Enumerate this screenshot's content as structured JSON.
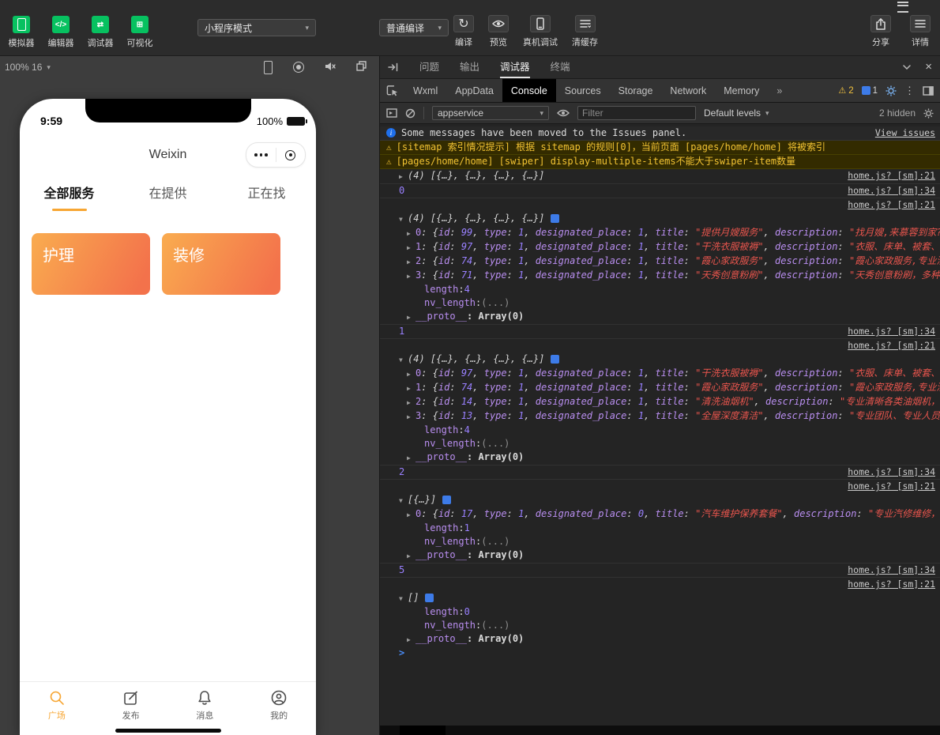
{
  "header": {
    "nav_buttons": [
      {
        "label": "模拟器"
      },
      {
        "label": "编辑器"
      },
      {
        "label": "调试器"
      },
      {
        "label": "可视化"
      }
    ],
    "mode_select": {
      "value": "小程序模式"
    },
    "compile_select": {
      "value": "普通编译"
    },
    "actions": [
      {
        "label": "编译"
      },
      {
        "label": "预览"
      },
      {
        "label": "真机调试"
      },
      {
        "label": "清缓存"
      }
    ],
    "share": {
      "label": "分享"
    },
    "detail": {
      "label": "详情"
    }
  },
  "simulator": {
    "zoom_label": "100% 16",
    "phone": {
      "time": "9:59",
      "battery": "100%",
      "title": "Weixin",
      "tabs": [
        {
          "label": "全部服务",
          "active": true
        },
        {
          "label": "在提供"
        },
        {
          "label": "正在找"
        }
      ],
      "cards": [
        {
          "label": "护理"
        },
        {
          "label": "装修"
        }
      ],
      "tabbar": [
        {
          "label": "广场",
          "active": true
        },
        {
          "label": "发布"
        },
        {
          "label": "消息"
        },
        {
          "label": "我的"
        }
      ]
    }
  },
  "devtools": {
    "drawer_tabs": [
      {
        "label": "问题"
      },
      {
        "label": "输出"
      },
      {
        "label": "调试器",
        "active": true
      },
      {
        "label": "终端"
      }
    ],
    "inspector_tabs": [
      {
        "label": "Wxml"
      },
      {
        "label": "AppData"
      },
      {
        "label": "Console",
        "active": true
      },
      {
        "label": "Sources"
      },
      {
        "label": "Storage"
      },
      {
        "label": "Network"
      },
      {
        "label": "Memory"
      }
    ],
    "overflow_label": "»",
    "warn_count": "2",
    "issue_count": "1",
    "toolbar": {
      "context": "appservice",
      "filter_placeholder": "Filter",
      "levels": "Default levels",
      "hidden_label": "2 hidden"
    },
    "console": {
      "obj_keys": [
        "id",
        "type",
        "designated_place",
        "title",
        "description"
      ],
      "proto_label": "__proto__",
      "proto_val": ": Array(0)",
      "prompt_char": ">",
      "rows": [
        {
          "kind": "info",
          "text": "Some messages have been moved to the Issues panel.",
          "link": "View issues"
        },
        {
          "kind": "warn",
          "text": "[sitemap 索引情况提示] 根据 sitemap 的规则[0]，当前页面 [pages/home/home] 将被索引"
        },
        {
          "kind": "warn",
          "text": "[pages/home/home] [swiper] display-multiple-items不能大于swiper-item数量"
        },
        {
          "kind": "arr",
          "state": "closed",
          "preview": "(4) [{…}, {…}, {…}, {…}]",
          "source": "home.js? [sm]:21",
          "sep": true
        },
        {
          "kind": "val",
          "text": "0",
          "source": "home.js? [sm]:34",
          "sep": true
        },
        {
          "kind": "val",
          "text": "",
          "source": "home.js? [sm]:21"
        },
        {
          "kind": "arr",
          "state": "open",
          "preview": "(4) [{…}, {…}, {…}, {…}]",
          "copy": true
        },
        {
          "kind": "obj",
          "idx": "0",
          "id": "99",
          "type": "1",
          "place": "1",
          "title": "提供月嫂服务",
          "desc": "找月嫂,来慕蓉到家?,服…"
        },
        {
          "kind": "obj",
          "idx": "1",
          "id": "97",
          "type": "1",
          "place": "1",
          "title": "干洗衣服被褥",
          "desc": "衣服、床单、被套、牛…"
        },
        {
          "kind": "obj",
          "idx": "2",
          "id": "74",
          "type": "1",
          "place": "1",
          "title": "霞心家政服务",
          "desc": "霞心家政服务,专业清…"
        },
        {
          "kind": "obj",
          "idx": "3",
          "id": "71",
          "type": "1",
          "place": "1",
          "title": "天秀创意粉刷",
          "desc": "天秀创意粉刷，多种模…"
        },
        {
          "kind": "kv",
          "k": "length",
          "v": "4",
          "cls": "num"
        },
        {
          "kind": "kv",
          "k": "nv_length",
          "v": "(...)",
          "cls": "dim"
        },
        {
          "kind": "proto",
          "sep": true
        },
        {
          "kind": "val",
          "text": "1",
          "source": "home.js? [sm]:34",
          "sep": true
        },
        {
          "kind": "val",
          "text": "",
          "source": "home.js? [sm]:21"
        },
        {
          "kind": "arr",
          "state": "open",
          "preview": "(4) [{…}, {…}, {…}, {…}]",
          "copy": true
        },
        {
          "kind": "obj",
          "idx": "0",
          "id": "97",
          "type": "1",
          "place": "1",
          "title": "干洗衣服被褥",
          "desc": "衣服、床单、被套、牛…"
        },
        {
          "kind": "obj",
          "idx": "1",
          "id": "74",
          "type": "1",
          "place": "1",
          "title": "霞心家政服务",
          "desc": "霞心家政服务,专业清…"
        },
        {
          "kind": "obj",
          "idx": "2",
          "id": "14",
          "type": "1",
          "place": "1",
          "title": "清洗油烟机",
          "desc": "专业清晰各类油烟机，让…"
        },
        {
          "kind": "obj",
          "idx": "3",
          "id": "13",
          "type": "1",
          "place": "1",
          "title": "全屋深度清洁",
          "desc": "专业团队、专业人员、…"
        },
        {
          "kind": "kv",
          "k": "length",
          "v": "4",
          "cls": "num"
        },
        {
          "kind": "kv",
          "k": "nv_length",
          "v": "(...)",
          "cls": "dim"
        },
        {
          "kind": "proto",
          "sep": true
        },
        {
          "kind": "val",
          "text": "2",
          "source": "home.js? [sm]:34",
          "sep": true
        },
        {
          "kind": "val",
          "text": "",
          "source": "home.js? [sm]:21"
        },
        {
          "kind": "arr",
          "state": "open",
          "preview": "[{…}]",
          "copy": true
        },
        {
          "kind": "obj",
          "idx": "0",
          "id": "17",
          "type": "1",
          "place": "0",
          "title": "汽车维护保养套餐",
          "desc": "专业汽修维修，多…"
        },
        {
          "kind": "kv",
          "k": "length",
          "v": "1",
          "cls": "num"
        },
        {
          "kind": "kv",
          "k": "nv_length",
          "v": "(...)",
          "cls": "dim"
        },
        {
          "kind": "proto",
          "sep": true
        },
        {
          "kind": "val",
          "text": "5",
          "source": "home.js? [sm]:34",
          "sep": true
        },
        {
          "kind": "val",
          "text": "",
          "source": "home.js? [sm]:21"
        },
        {
          "kind": "arr",
          "state": "open",
          "preview": "[]",
          "copy": true
        },
        {
          "kind": "kv",
          "k": "length",
          "v": "0",
          "cls": "num"
        },
        {
          "kind": "kv",
          "k": "nv_length",
          "v": "(...)",
          "cls": "dim"
        },
        {
          "kind": "proto"
        },
        {
          "kind": "prompt"
        }
      ]
    }
  }
}
